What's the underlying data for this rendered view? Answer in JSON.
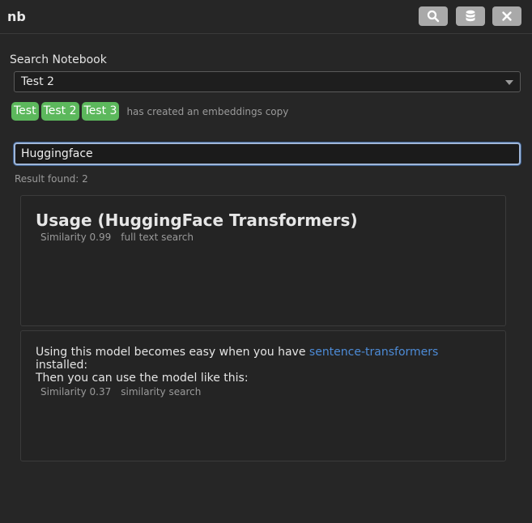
{
  "app": {
    "title": "nb"
  },
  "toolbar": {
    "buttons": [
      {
        "name": "search",
        "icon": "search-icon"
      },
      {
        "name": "database",
        "icon": "database-icon"
      },
      {
        "name": "close",
        "icon": "close-icon"
      }
    ]
  },
  "search": {
    "label": "Search Notebook",
    "notebook_selected": "Test 2",
    "query": "Huggingface",
    "result_count": "Result found: 2"
  },
  "embeddings": {
    "tags": [
      "Test",
      "Test 2",
      "Test 3"
    ],
    "note": "has created an embeddings copy"
  },
  "results": [
    {
      "heading": "Usage (HuggingFace Transformers)",
      "similarity": "Similarity 0.99",
      "method": "full text search"
    },
    {
      "text_before": "Using this model becomes easy when you have ",
      "link": "sentence-transformers",
      "text_after": "installed:",
      "line2": "Then you can use the model like this:",
      "similarity": "Similarity 0.37",
      "method": "similarity search"
    }
  ],
  "colors": {
    "background": "#262626",
    "tag": "#5cb85c",
    "link": "#4d8bd6",
    "focus": "#9fb6d8"
  }
}
